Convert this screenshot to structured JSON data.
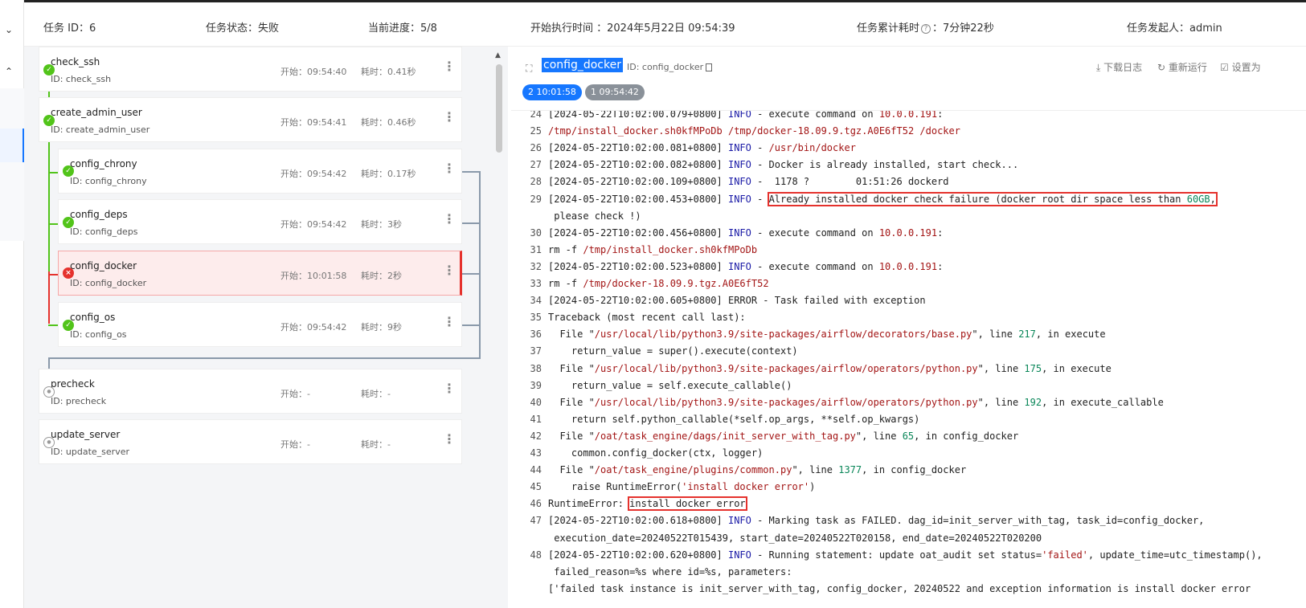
{
  "header": {
    "task_id": "任务 ID：6",
    "task_status": "任务状态：失败",
    "progress": "当前进度：5/8",
    "start_time": "开始执行时间 ：2024年5月22日 09:54:39",
    "elapsed_label": "任务累计耗时",
    "elapsed_value": "：7分钟22秒",
    "initiator": "任务发起人：admin"
  },
  "tasks": [
    {
      "name": "check_ssh",
      "id": "ID: check_ssh",
      "start": "开始：09:54:40",
      "cost": "耗时：0.41秒",
      "status": "success"
    },
    {
      "name": "create_admin_user",
      "id": "ID: create_admin_user",
      "start": "开始：09:54:41",
      "cost": "耗时：0.46秒",
      "status": "success"
    },
    {
      "name": "config_chrony",
      "id": "ID: config_chrony",
      "start": "开始：09:54:42",
      "cost": "耗时：0.17秒",
      "status": "success"
    },
    {
      "name": "config_deps",
      "id": "ID: config_deps",
      "start": "开始：09:54:42",
      "cost": "耗时：3秒",
      "status": "success"
    },
    {
      "name": "config_docker",
      "id": "ID: config_docker",
      "start": "开始：10:01:58",
      "cost": "耗时：2秒",
      "status": "failed"
    },
    {
      "name": "config_os",
      "id": "ID: config_os",
      "start": "开始：09:54:42",
      "cost": "耗时：9秒",
      "status": "success"
    },
    {
      "name": "precheck",
      "id": "ID: precheck",
      "start": "开始：-",
      "cost": "耗时：-",
      "status": "pending"
    },
    {
      "name": "update_server",
      "id": "ID: update_server",
      "start": "开始：-",
      "cost": "耗时：-",
      "status": "pending"
    }
  ],
  "log": {
    "title": "config_docker",
    "id_label": "ID: config_docker",
    "download_label": "下载日志",
    "rerun_label": "重新运行",
    "settings_label": "设置为",
    "runs": [
      "2 10:01:58",
      "1 09:54:42"
    ]
  },
  "log_lines": [
    {
      "n": "24",
      "text": "[2024-05-22T10:02:00.079+0800] INFO - execute command on 10.0.0.191:"
    },
    {
      "n": "25",
      "text": "/tmp/install_docker.sh0kfMPoDb /tmp/docker-18.09.9.tgz.A0E6fT52 /docker"
    },
    {
      "n": "26",
      "text": "[2024-05-22T10:02:00.081+0800] INFO - /usr/bin/docker"
    },
    {
      "n": "27",
      "text": "[2024-05-22T10:02:00.082+0800] INFO - Docker is already installed, start check..."
    },
    {
      "n": "28",
      "text": "[2024-05-22T10:02:00.109+0800] INFO -  1178 ?        01:51:26 dockerd"
    },
    {
      "n": "29",
      "text": "[2024-05-22T10:02:00.453+0800] INFO - Already installed docker check failure (docker root dir space less than 60GB,"
    },
    {
      "n": "",
      "text": " please check !)"
    },
    {
      "n": "30",
      "text": "[2024-05-22T10:02:00.456+0800] INFO - execute command on 10.0.0.191:"
    },
    {
      "n": "31",
      "text": "rm -f /tmp/install_docker.sh0kfMPoDb"
    },
    {
      "n": "32",
      "text": "[2024-05-22T10:02:00.523+0800] INFO - execute command on 10.0.0.191:"
    },
    {
      "n": "33",
      "text": "rm -f /tmp/docker-18.09.9.tgz.A0E6fT52"
    },
    {
      "n": "34",
      "text": "[2024-05-22T10:02:00.605+0800] ERROR - Task failed with exception"
    },
    {
      "n": "35",
      "text": "Traceback (most recent call last):"
    },
    {
      "n": "36",
      "text": "  File \"/usr/local/lib/python3.9/site-packages/airflow/decorators/base.py\", line 217, in execute"
    },
    {
      "n": "37",
      "text": "    return_value = super().execute(context)"
    },
    {
      "n": "38",
      "text": "  File \"/usr/local/lib/python3.9/site-packages/airflow/operators/python.py\", line 175, in execute"
    },
    {
      "n": "39",
      "text": "    return_value = self.execute_callable()"
    },
    {
      "n": "40",
      "text": "  File \"/usr/local/lib/python3.9/site-packages/airflow/operators/python.py\", line 192, in execute_callable"
    },
    {
      "n": "41",
      "text": "    return self.python_callable(*self.op_args, **self.op_kwargs)"
    },
    {
      "n": "42",
      "text": "  File \"/oat/task_engine/dags/init_server_with_tag.py\", line 65, in config_docker"
    },
    {
      "n": "43",
      "text": "    common.config_docker(ctx, logger)"
    },
    {
      "n": "44",
      "text": "  File \"/oat/task_engine/plugins/common.py\", line 1377, in config_docker"
    },
    {
      "n": "45",
      "text": "    raise RuntimeError('install docker error')"
    },
    {
      "n": "46",
      "text": "RuntimeError: install docker error"
    },
    {
      "n": "47",
      "text": "[2024-05-22T10:02:00.618+0800] INFO - Marking task as FAILED. dag_id=init_server_with_tag, task_id=config_docker,"
    },
    {
      "n": "",
      "text": " execution_date=20240522T015439, start_date=20240522T020158, end_date=20240522T020200"
    },
    {
      "n": "48",
      "text": "[2024-05-22T10:02:00.620+0800] INFO - Running statement: update oat_audit set status='failed', update_time=utc_timestamp(),"
    },
    {
      "n": "",
      "text": " failed_reason=%s where id=%s, parameters:"
    },
    {
      "n": "",
      "text": "['failed task instance is init_server_with_tag, config_docker, 20240522 and exception information is install docker error"
    }
  ]
}
